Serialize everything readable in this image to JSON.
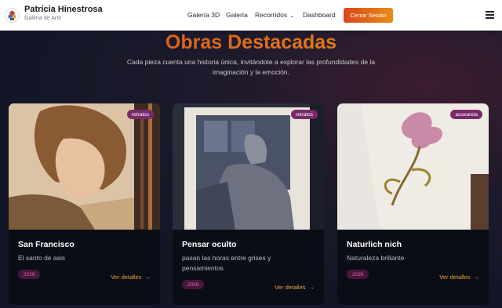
{
  "header": {
    "brand_name": "Patricia Hinestrosa",
    "brand_sub": "Galería de Arte",
    "nav": [
      "Galería 3D",
      "Galería",
      "Recorridos",
      "Dashboard"
    ],
    "logout_label": "Cerrar Sesión"
  },
  "hero": {
    "title": "Obras Destacadas",
    "subtitle": "Cada pieza cuenta una historia única, invitándote a explorar las profundidades de la imaginación y la emoción."
  },
  "cards": [
    {
      "title": "San Francisco",
      "desc": "El santo de asis",
      "category": "retratos",
      "year": "2026",
      "details": "Ver detalles"
    },
    {
      "title": "Pensar oculto",
      "desc": "pasan las horas entre grises y pensamientos",
      "category": "retratos",
      "year": "2026",
      "details": "Ver detalles"
    },
    {
      "title": "Naturlich nich",
      "desc": "Naturaleza brillante",
      "category": "acuearela",
      "year": "2026",
      "details": "Ver detalles"
    }
  ],
  "colors": {
    "accent": "#e07a1c",
    "badge": "#7a2a6b",
    "background": "#121626"
  }
}
